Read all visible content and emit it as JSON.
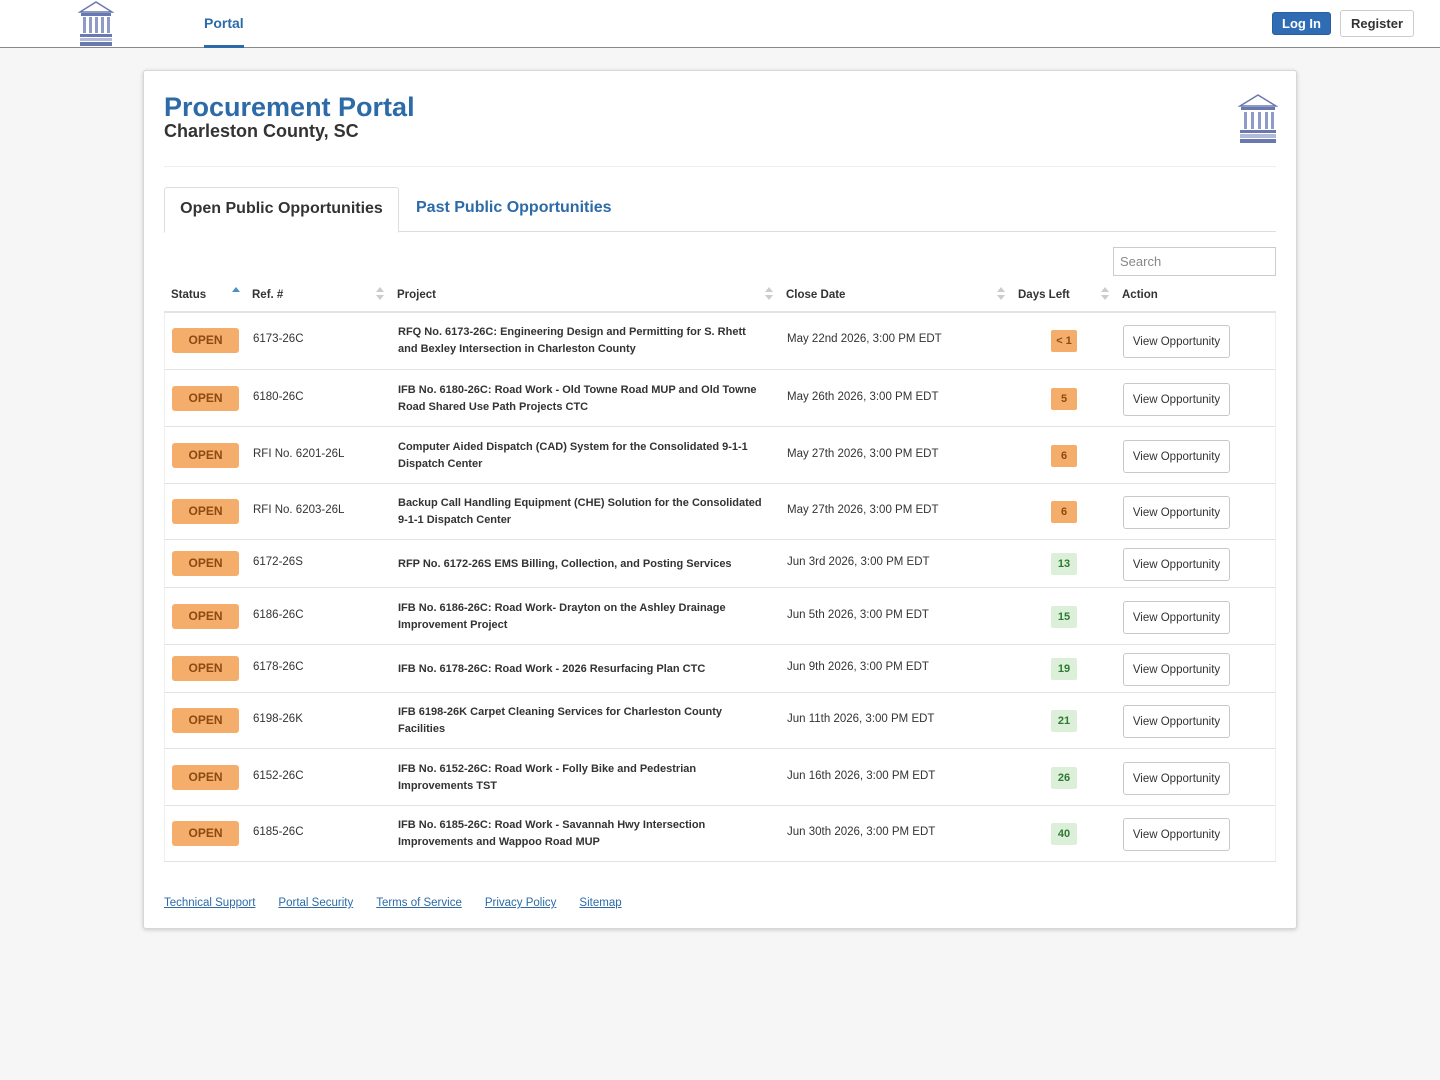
{
  "nav": {
    "logo_icon": "charleston-county-seal-icon",
    "tab_label": "Portal",
    "login_label": "Log In",
    "register_label": "Register"
  },
  "header": {
    "title": "Procurement Portal",
    "subtitle": "Charleston County, SC",
    "logo_icon": "charleston-county-seal-icon"
  },
  "tabs": {
    "open_label": "Open Public Opportunities",
    "past_label": "Past Public Opportunities"
  },
  "search": {
    "placeholder": "Search"
  },
  "table": {
    "columns": [
      "Status",
      "Ref. #",
      "Project",
      "Close Date",
      "Days Left",
      "Action"
    ],
    "rows": [
      {
        "status": "OPEN",
        "ref": "6173-26C",
        "project": "RFQ No. 6173-26C: Engineering Design and Permitting for S. Rhett and Bexley Intersection in Charleston County",
        "close": "May 22nd 2026, 3:00 PM EDT",
        "days": "< 1",
        "days_status": "warn",
        "action": "View Opportunity"
      },
      {
        "status": "OPEN",
        "ref": "6180-26C",
        "project": "IFB No. 6180-26C: Road Work - Old Towne Road MUP and Old Towne Road Shared Use Path Projects CTC",
        "close": "May 26th 2026, 3:00 PM EDT",
        "days": "5",
        "days_status": "warn",
        "action": "View Opportunity"
      },
      {
        "status": "OPEN",
        "ref": "RFI No. 6201-26L",
        "project": "Computer Aided Dispatch (CAD) System for the Consolidated 9-1-1 Dispatch Center",
        "close": "May 27th 2026, 3:00 PM EDT",
        "days": "6",
        "days_status": "warn",
        "action": "View Opportunity"
      },
      {
        "status": "OPEN",
        "ref": "RFI No. 6203-26L",
        "project": "Backup Call Handling Equipment (CHE) Solution for the Consolidated 9-1-1 Dispatch Center",
        "close": "May 27th 2026, 3:00 PM EDT",
        "days": "6",
        "days_status": "warn",
        "action": "View Opportunity"
      },
      {
        "status": "OPEN",
        "ref": "6172-26S",
        "project": "RFP No. 6172-26S EMS Billing, Collection, and Posting Services",
        "close": "Jun 3rd 2026, 3:00 PM EDT",
        "days": "13",
        "days_status": "ok",
        "action": "View Opportunity"
      },
      {
        "status": "OPEN",
        "ref": "6186-26C",
        "project": "IFB No. 6186-26C: Road Work- Drayton on the Ashley Drainage Improvement Project",
        "close": "Jun 5th 2026, 3:00 PM EDT",
        "days": "15",
        "days_status": "ok",
        "action": "View Opportunity"
      },
      {
        "status": "OPEN",
        "ref": "6178-26C",
        "project": "IFB No. 6178-26C: Road Work - 2026 Resurfacing Plan CTC",
        "close": "Jun 9th 2026, 3:00 PM EDT",
        "days": "19",
        "days_status": "ok",
        "action": "View Opportunity"
      },
      {
        "status": "OPEN",
        "ref": "6198-26K",
        "project": "IFB 6198-26K Carpet Cleaning Services for Charleston County Facilities",
        "close": "Jun 11th 2026, 3:00 PM EDT",
        "days": "21",
        "days_status": "ok",
        "action": "View Opportunity"
      },
      {
        "status": "OPEN",
        "ref": "6152-26C",
        "project": "IFB No. 6152-26C: Road Work - Folly Bike and Pedestrian Improvements TST",
        "close": "Jun 16th 2026, 3:00 PM EDT",
        "days": "26",
        "days_status": "ok",
        "action": "View Opportunity"
      },
      {
        "status": "OPEN",
        "ref": "6185-26C",
        "project": "IFB No. 6185-26C: Road Work - Savannah Hwy Intersection Improvements and Wappoo Road MUP",
        "close": "Jun 30th 2026, 3:00 PM EDT",
        "days": "40",
        "days_status": "ok",
        "action": "View Opportunity"
      }
    ]
  },
  "footer": {
    "links": [
      "Technical Support",
      "Portal Security",
      "Terms of Service",
      "Privacy Policy",
      "Sitemap"
    ]
  },
  "colors": {
    "brand_blue": "#2c6ba8",
    "open_badge": "#f5ad6b",
    "days_ok": "#dcefd9"
  }
}
